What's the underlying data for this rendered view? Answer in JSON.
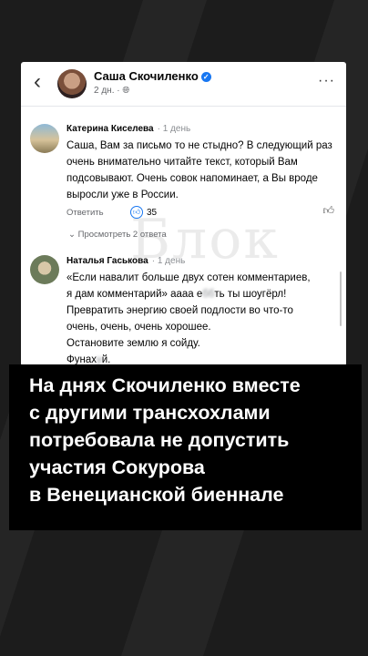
{
  "post": {
    "author": "Саша Скочиленко",
    "time": "2 дн.",
    "more_label": "···",
    "back_label": "‹"
  },
  "comments": [
    {
      "author": "Катерина Киселева",
      "time": "1 день",
      "text": "Саша, Вам за письмо то не стыдно? В следующий раз очень внимательно читайте текст, который Вам подсовывают. Очень совок напоминает, а Вы вроде выросли уже в России.",
      "reply_label": "Ответить",
      "likes": "35",
      "view_replies": "Просмотреть 2 ответа"
    },
    {
      "author": "Наталья Гаськова",
      "time": "1 день",
      "text_lines": [
        "«Если навалит больше двух сотен комментариев,",
        "я дам комментарий» аааа е",
        "ть ты шоугёрл!",
        "Превратить энергию своей подлости во что-то",
        "очень, очень, очень хорошее.",
        "Остановите землю я сойду.",
        "Фунах",
        "й."
      ],
      "blurred_1": "бб",
      "blurred_2": "у"
    }
  ],
  "watermark": "Блок",
  "overlay": {
    "lines": [
      "На днях Скочиленко вместе",
      "с другими трансхохлами",
      "потребовала не допустить",
      "участия Сокурова",
      "в Венецианской биеннале"
    ]
  },
  "colors": {
    "accent": "#1877f2",
    "background": "#1c1c1c",
    "overlay": "#000000"
  }
}
